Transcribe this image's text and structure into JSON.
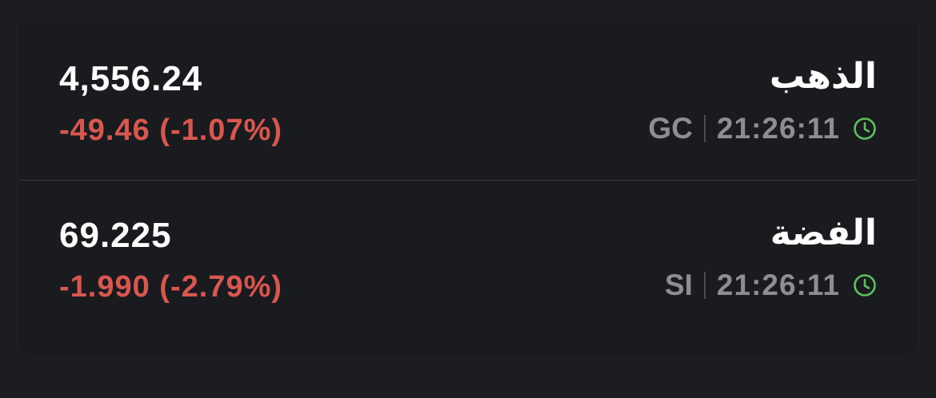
{
  "items": [
    {
      "name": "الذهب",
      "price": "4,556.24",
      "change": "-49.46 (-1.07%)",
      "symbol": "GC",
      "time": "21:26:11",
      "icon": "clock-icon"
    },
    {
      "name": "الفضة",
      "price": "69.225",
      "change": "-1.990 (-2.79%)",
      "symbol": "SI",
      "time": "21:26:11",
      "icon": "clock-icon"
    }
  ],
  "colors": {
    "background": "#1c1d21",
    "card": "#191b1f",
    "negative": "#d9574e",
    "muted": "#8d8e93",
    "clock": "#5cc25b",
    "text": "#ffffff"
  }
}
